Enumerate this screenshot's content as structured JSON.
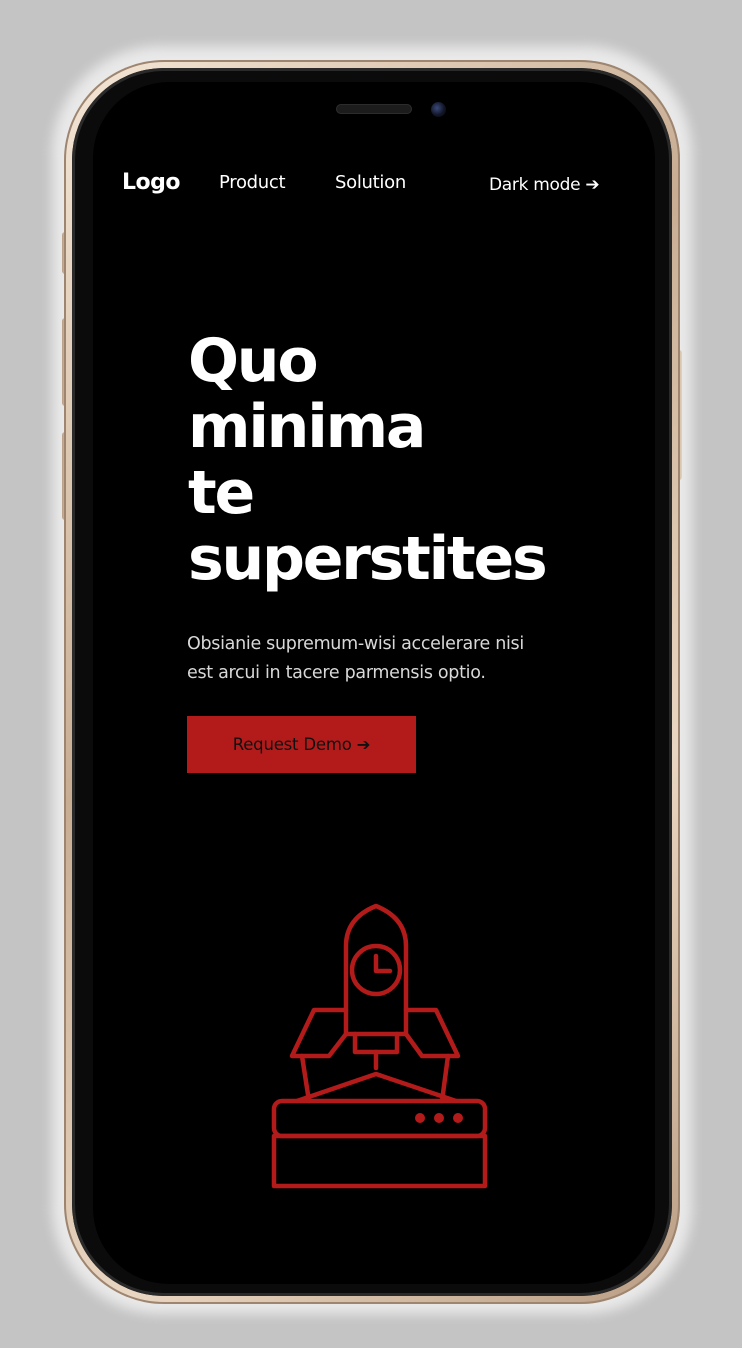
{
  "colors": {
    "background": "#000000",
    "accent": "#b31b1b",
    "text": "#ffffff",
    "muted_text": "#d8d8d8"
  },
  "nav": {
    "logo": "Logo",
    "links": [
      "Product",
      "Solution"
    ],
    "dark_mode": "Dark mode ➔"
  },
  "hero": {
    "title_lines": [
      "Quo",
      "minima",
      "te",
      "superstites"
    ],
    "subtitle_lines": [
      "Obsianie supremum-wisi accelerare nisi",
      "est arcui in tacere parmensis optio."
    ],
    "cta_label": "Request Demo ➔"
  },
  "illustration": {
    "icon": "rocket-launch-icon"
  }
}
